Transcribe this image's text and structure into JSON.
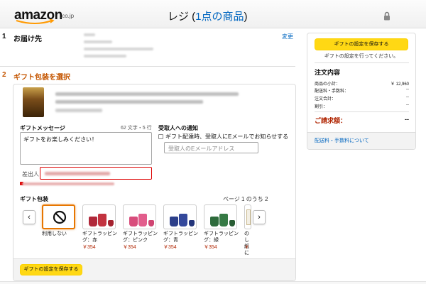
{
  "header": {
    "logo": "amazon",
    "logo_suffix": ".co.jp",
    "title_prefix": "レジ (",
    "title_count": "1点の商品",
    "title_suffix": ")"
  },
  "step1": {
    "number": "1",
    "title": "お届け先",
    "change_link": "変更"
  },
  "step2": {
    "number": "2",
    "title": "ギフト包装を選択",
    "message_label": "ギフトメッセージ",
    "message_counter": "62 文字・5 行",
    "message_value": "ギフトをお楽しみください！",
    "sender_label": "差出人",
    "recipient_label": "受取人への通知",
    "notify_text": "ギフト配達時、受取人にEメールでお知らせする",
    "email_placeholder": "受取人のEメールアドレス",
    "wrap_label": "ギフト包装",
    "page_indicator": "ページ 1 のうち 2",
    "prev_arrow": "‹",
    "next_arrow": "›",
    "wraps": [
      {
        "name": "利用しない",
        "price": ""
      },
      {
        "name": "ギフトラッピング：赤",
        "price": "￥354"
      },
      {
        "name": "ギフトラッピング：ピンク",
        "price": "￥354"
      },
      {
        "name": "ギフトラッピング：青",
        "price": "￥354"
      },
      {
        "name": "ギフトラッピング：緑",
        "price": "￥354"
      },
      {
        "name": "のし紙に",
        "price": "￥"
      }
    ],
    "save_button": "ギフトの設定を保存する"
  },
  "summary": {
    "save_button": "ギフトの設定を保存する",
    "note": "ギフトの設定を行ってください。",
    "title": "注文内容",
    "rows": [
      {
        "label": "商品の小計：",
        "value": "￥ 12,960"
      },
      {
        "label": "配送料・手数料：",
        "value": "--"
      },
      {
        "label": "注文合計：",
        "value": "--"
      },
      {
        "label": "割引：",
        "value": "--"
      }
    ],
    "total_label": "ご請求額：",
    "total_value": "--",
    "fee_link": "配送料・手数料について"
  },
  "colors": {
    "accent_orange": "#c45500",
    "link_blue": "#0066c0",
    "price_red": "#b12704",
    "button_yellow": "#ffd814"
  }
}
